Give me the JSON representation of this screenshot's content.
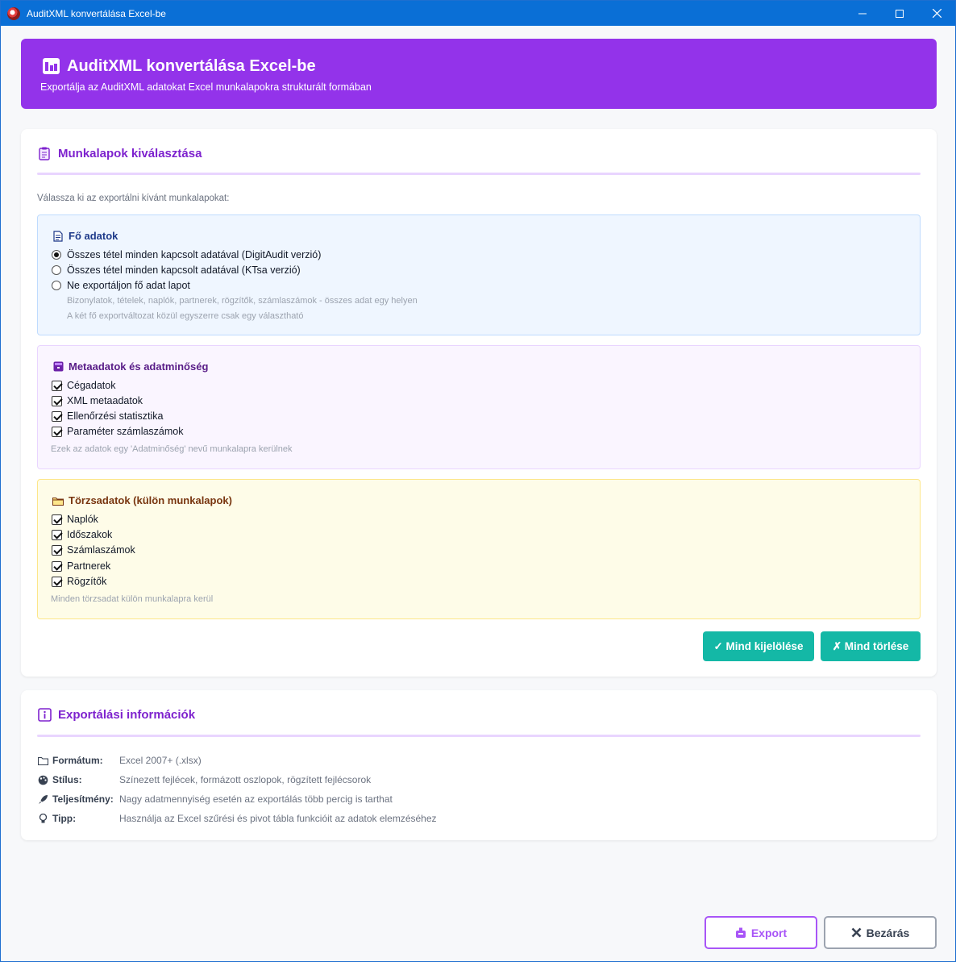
{
  "window": {
    "title": "AuditXML konvertálása Excel-be",
    "controls": {
      "minimize": "—",
      "maximize": "☐",
      "close": "✕"
    }
  },
  "header": {
    "icon": "chart-icon",
    "title": "AuditXML konvertálása Excel-be",
    "subtitle": "Exportálja az AuditXML adatokat Excel munkalapokra strukturált formában"
  },
  "sheets": {
    "title": "Munkalapok kiválasztása",
    "icon": "clipboard-icon",
    "hint": "Válassza ki az exportálni kívánt munkalapokat:",
    "main_group": {
      "title": "Fő adatok",
      "icon": "document-icon",
      "options": [
        {
          "label": "Összes tétel minden kapcsolt adatával (DigitAudit verzió)",
          "selected": true
        },
        {
          "label": "Összes tétel minden kapcsolt adatával (KTsa verzió)",
          "selected": false
        },
        {
          "label": "Ne exportáljon fő adat lapot",
          "selected": false
        }
      ],
      "note1": "Bizonylatok, tételek, naplók, partnerek, rögzítők, számlaszámok - összes adat egy helyen",
      "note2": "A két fő exportváltozat közül egyszerre csak egy választható"
    },
    "meta_group": {
      "title": "Metaadatok és adatminőség",
      "icon": "archive-icon",
      "items": [
        {
          "label": "Cégadatok",
          "checked": true
        },
        {
          "label": "XML metaadatok",
          "checked": true
        },
        {
          "label": "Ellenőrzési statisztika",
          "checked": true
        },
        {
          "label": "Paraméter számlaszámok",
          "checked": true
        }
      ],
      "note": "Ezek az adatok egy 'Adatminőség' nevű munkalapra kerülnek"
    },
    "master_group": {
      "title": "Törzsadatok (külön munkalapok)",
      "icon": "folder-icon",
      "items": [
        {
          "label": "Naplók",
          "checked": true
        },
        {
          "label": "Időszakok",
          "checked": true
        },
        {
          "label": "Számlaszámok",
          "checked": true
        },
        {
          "label": "Partnerek",
          "checked": true
        },
        {
          "label": "Rögzítők",
          "checked": true
        }
      ],
      "note": "Minden törzsadat külön munkalapra kerül"
    },
    "select_all": "✓ Mind kijelölése",
    "clear_all": "✗ Mind törlése"
  },
  "info": {
    "title": "Exportálási információk",
    "icon": "info-icon",
    "rows": [
      {
        "icon": "folder-icon",
        "label": "Formátum:",
        "value": "Excel 2007+ (.xlsx)"
      },
      {
        "icon": "palette-icon",
        "label": "Stílus:",
        "value": "Színezett fejlécek, formázott oszlopok, rögzített fejlécsorok"
      },
      {
        "icon": "rocket-icon",
        "label": "Teljesítmény:",
        "value": "Nagy adatmennyiség esetén az exportálás több percig is tarthat"
      },
      {
        "icon": "bulb-icon",
        "label": "Tipp:",
        "value": "Használja az Excel szűrési és pivot tábla funkcióit az adatok elemzéséhez"
      }
    ]
  },
  "footer": {
    "export": "Export",
    "close": "Bezárás"
  },
  "colors": {
    "titlebar": "#0a6fd6",
    "accent": "#9333ea",
    "teal": "#14b8a6"
  }
}
